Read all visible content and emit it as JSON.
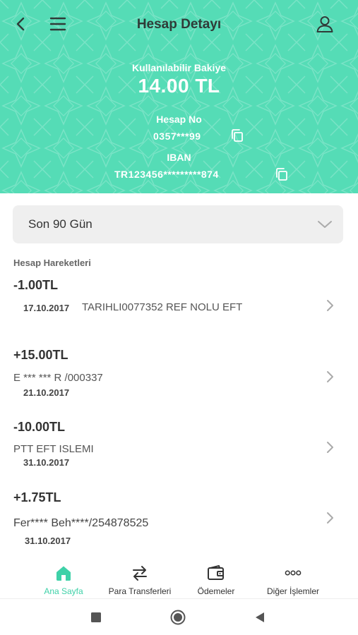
{
  "header": {
    "title": "Hesap Detayı",
    "balance_label": "Kullanılabilir Bakiye",
    "balance_value": "14.00 TL",
    "account_label": "Hesap No",
    "account_value": "0357***99",
    "iban_label": "IBAN",
    "iban_value": "TR123456*********874"
  },
  "filter": {
    "selected": "Son 90 Gün"
  },
  "section_title": "Hesap Hareketleri",
  "transactions": [
    {
      "amount": "-1.00TL",
      "date": "17.10.2017",
      "description": "TARIHLI0077352 REF NOLU EFT"
    },
    {
      "amount": "+15.00TL",
      "description": "E ***     *** R  /000337",
      "date": "21.10.2017"
    },
    {
      "amount": "-10.00TL",
      "description": "PTT EFT ISLEMI",
      "date": "31.10.2017"
    },
    {
      "amount": "+1.75TL",
      "description": "Fer**** Beh****/254878525",
      "date": "31.10.2017"
    }
  ],
  "nav": {
    "home": "Ana Sayfa",
    "transfers": "Para Transferleri",
    "payments": "Ödemeler",
    "other": "Diğer İşlemler"
  },
  "colors": {
    "header_bg": "#55dcb6",
    "accent": "#3fd1a8"
  },
  "icons": {
    "back": "chevron-left-icon",
    "menu": "hamburger-menu-icon",
    "profile": "user-icon",
    "copy": "copy-icon",
    "dropdown": "chevron-down-icon",
    "row": "chevron-right-icon",
    "home": "home-icon",
    "transfer": "transfer-arrows-icon",
    "payments": "wallet-icon",
    "other": "more-dots-icon"
  }
}
